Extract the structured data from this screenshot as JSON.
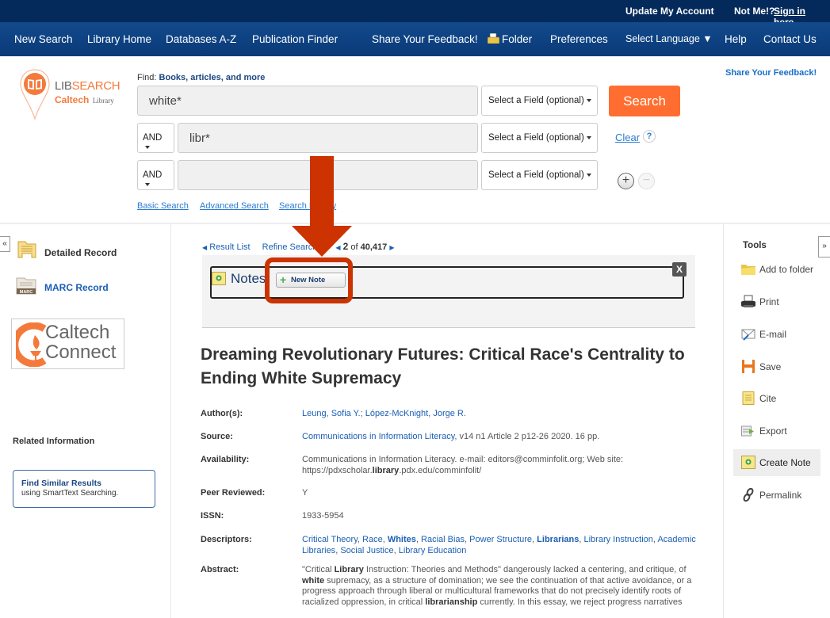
{
  "topbar": {
    "update_account": "Update My Account",
    "not_me": "Not Me!?",
    "sign_in": "Sign in here."
  },
  "nav": {
    "items": [
      "New Search",
      "Library Home",
      "Databases A-Z",
      "Publication Finder",
      "Share Your Feedback!",
      "Folder",
      "Preferences",
      "Select Language ▼",
      "Help",
      "Contact Us"
    ]
  },
  "logo": {
    "lib": "LIB",
    "search": "SEARCH",
    "caltech": "Caltech",
    "library": "Library"
  },
  "search": {
    "find_prefix": "Find:",
    "find_label": "Books, articles, and more",
    "rows": [
      {
        "bool": "",
        "value": "white*",
        "field": "Select a Field (optional)"
      },
      {
        "bool": "AND",
        "value": "libr*",
        "field": "Select a Field (optional)"
      },
      {
        "bool": "AND",
        "value": "",
        "field": "Select a Field (optional)"
      }
    ],
    "search_button": "Search",
    "clear": "Clear",
    "help": "?",
    "add_row": "+",
    "remove_row": "−",
    "links": [
      "Basic Search",
      "Advanced Search",
      "Search History"
    ],
    "feedback": "Share Your Feedback!"
  },
  "left": {
    "collapse": "«",
    "detailed_record": "Detailed Record",
    "marc_record": "MARC Record",
    "marc_badge": "MARC",
    "connect_line1": "Caltech",
    "connect_line2": "Connect",
    "related_info": "Related Information",
    "find_similar_title": "Find Similar Results",
    "find_similar_sub": "using SmartText Searching."
  },
  "record_nav": {
    "result_list": "Result List",
    "refine_search": "Refine Search",
    "position": "2",
    "of": "of",
    "total": "40,417"
  },
  "notes": {
    "title": "Notes",
    "new_note": "New Note",
    "close": "X"
  },
  "record": {
    "title": "Dreaming Revolutionary Futures: Critical Race's Centrality to Ending White Supremacy",
    "fields": {
      "authors_label": "Author(s):",
      "authors": [
        "Leung, Sofia Y.",
        "López-McKnight, Jorge R."
      ],
      "source_label": "Source:",
      "source_link": "Communications in Information Literacy",
      "source_rest": ", v14 n1 Article 2 p12-26 2020. 16 pp.",
      "availability_label": "Availability:",
      "availability_line1": "Communications in Information Literacy. e-mail: editors@comminfolit.org; Web site:",
      "availability_url_pre": "https://pdxscholar.",
      "availability_url_bold": "library",
      "availability_url_post": ".pdx.edu/comminfolit/",
      "peer_label": "Peer Reviewed:",
      "peer": "Y",
      "issn_label": "ISSN:",
      "issn": "1933-5954",
      "descriptors_label": "Descriptors:",
      "descriptors": [
        {
          "text": "Critical Theory",
          "bold": false
        },
        {
          "text": "Race",
          "bold": false
        },
        {
          "text": "Whites",
          "bold": true
        },
        {
          "text": "Racial Bias",
          "bold": false
        },
        {
          "text": "Power Structure",
          "bold": false
        },
        {
          "text": "Librarians",
          "bold": true
        },
        {
          "text": "Library Instruction",
          "bold": false
        },
        {
          "text": "Academic Libraries",
          "bold": false
        },
        {
          "text": "Social Justice",
          "bold": false
        },
        {
          "text": "Library Education",
          "bold": false
        }
      ],
      "abstract_label": "Abstract:",
      "abstract_lines": [
        "\"Critical Library Instruction: Theories and Methods\" dangerously lacked a centering, and critique, of",
        "white supremacy, as a structure of domination; we see the continuation of that active avoidance, or a",
        "progress approach through liberal or multicultural frameworks that do not precisely identify roots of",
        "racialized oppression, in critical librarianship currently. In this essay, we reject progress narratives"
      ]
    }
  },
  "tools": {
    "title": "Tools",
    "expand": "»",
    "items": [
      "Add to folder",
      "Print",
      "E-mail",
      "Save",
      "Cite",
      "Export",
      "Create Note",
      "Permalink"
    ]
  },
  "colors": {
    "topbar": "#042a5b",
    "navbar": "#0b3a78",
    "search_button": "#ff6e30",
    "annotation": "#cc3300",
    "logo_orange": "#f47a3c"
  }
}
